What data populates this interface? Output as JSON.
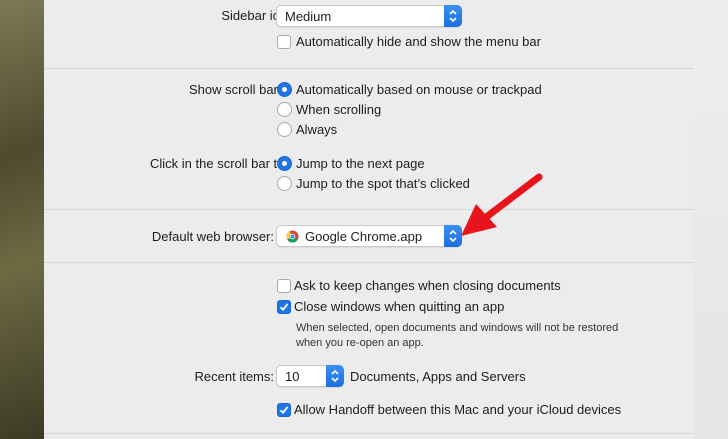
{
  "sidebar_icon_size": {
    "label": "Sidebar icon size:",
    "value": "Medium"
  },
  "menu_bar": {
    "label": "Automatically hide and show the menu bar",
    "checked": false
  },
  "scroll_bars": {
    "label": "Show scroll bars:",
    "options": [
      {
        "label": "Automatically based on mouse or trackpad",
        "selected": true
      },
      {
        "label": "When scrolling",
        "selected": false
      },
      {
        "label": "Always",
        "selected": false
      }
    ]
  },
  "scroll_click": {
    "label": "Click in the scroll bar to:",
    "options": [
      {
        "label": "Jump to the next page",
        "selected": true
      },
      {
        "label": "Jump to the spot that’s clicked",
        "selected": false
      }
    ]
  },
  "default_browser": {
    "label": "Default web browser:",
    "value": "Google Chrome.app",
    "icon": "chrome-icon"
  },
  "documents": {
    "ask_changes": {
      "label": "Ask to keep changes when closing documents",
      "checked": false
    },
    "close_windows": {
      "label": "Close windows when quitting an app",
      "checked": true
    },
    "hint_line1": "When selected, open documents and windows will not be restored",
    "hint_line2": "when you re-open an app."
  },
  "recent_items": {
    "label": "Recent items:",
    "value": "10",
    "suffix": "Documents, Apps and Servers"
  },
  "handoff": {
    "label": "Allow Handoff between this Mac and your iCloud devices",
    "checked": true
  },
  "colors": {
    "accent": "#1f75e6",
    "annotation_arrow": "#e8141b",
    "window_bg": "#ececec"
  }
}
